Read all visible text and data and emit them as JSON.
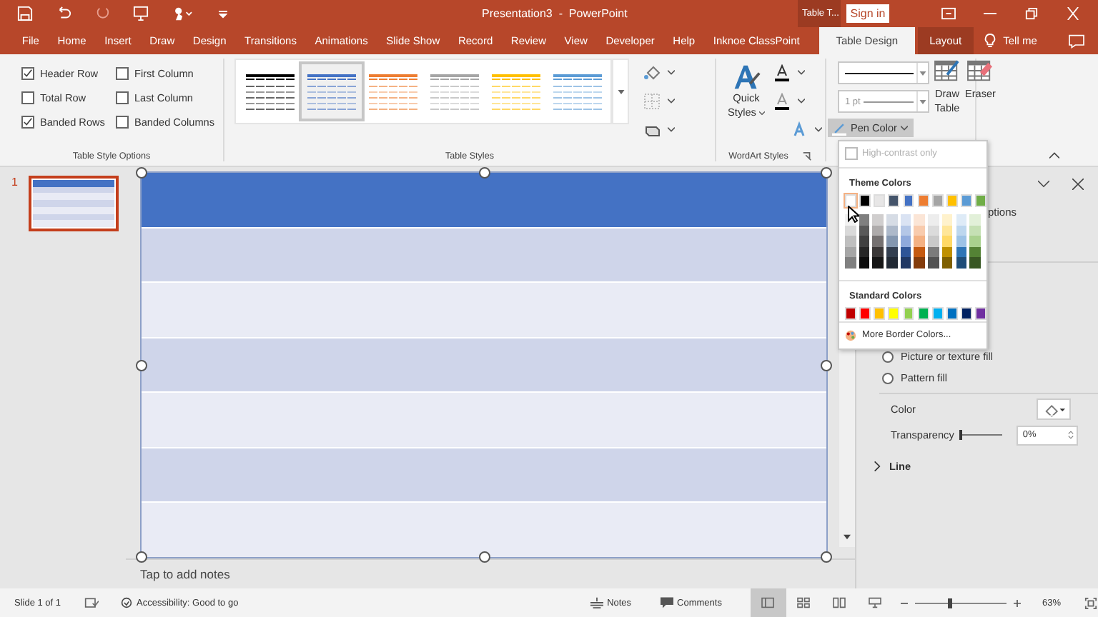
{
  "title_bar": {
    "title": "Presentation3  -  PowerPoint",
    "context_label": "Table T...",
    "sign_in": "Sign in"
  },
  "tabs": [
    {
      "label": "File",
      "selected": false,
      "kind": "normal"
    },
    {
      "label": "Home",
      "selected": false,
      "kind": "normal"
    },
    {
      "label": "Insert",
      "selected": false,
      "kind": "normal"
    },
    {
      "label": "Draw",
      "selected": false,
      "kind": "normal"
    },
    {
      "label": "Design",
      "selected": false,
      "kind": "normal"
    },
    {
      "label": "Transitions",
      "selected": false,
      "kind": "normal"
    },
    {
      "label": "Animations",
      "selected": false,
      "kind": "normal"
    },
    {
      "label": "Slide Show",
      "selected": false,
      "kind": "normal"
    },
    {
      "label": "Record",
      "selected": false,
      "kind": "normal"
    },
    {
      "label": "Review",
      "selected": false,
      "kind": "normal"
    },
    {
      "label": "View",
      "selected": false,
      "kind": "normal"
    },
    {
      "label": "Developer",
      "selected": false,
      "kind": "normal"
    },
    {
      "label": "Help",
      "selected": false,
      "kind": "normal"
    },
    {
      "label": "Inknoe ClassPoint",
      "selected": false,
      "kind": "normal"
    },
    {
      "label": "Table Design",
      "selected": true,
      "kind": "context"
    },
    {
      "label": "Layout",
      "selected": false,
      "kind": "context"
    }
  ],
  "tell_me": "Tell me",
  "ribbon": {
    "style_options": {
      "group_label": "Table Style Options",
      "items": [
        {
          "label": "Header Row",
          "checked": true
        },
        {
          "label": "First Column",
          "checked": false
        },
        {
          "label": "Total Row",
          "checked": false
        },
        {
          "label": "Last Column",
          "checked": false
        },
        {
          "label": "Banded Rows",
          "checked": true
        },
        {
          "label": "Banded Columns",
          "checked": false
        }
      ]
    },
    "table_styles": {
      "group_label": "Table Styles",
      "items": [
        {
          "color": "#000000",
          "selected": false
        },
        {
          "color": "#4472c4",
          "selected": true
        },
        {
          "color": "#ed7d31",
          "selected": false
        },
        {
          "color": "#a5a5a5",
          "selected": false
        },
        {
          "color": "#ffc000",
          "selected": false
        },
        {
          "color": "#5b9bd5",
          "selected": false
        }
      ]
    },
    "wordart": {
      "group_label": "WordArt Styles",
      "quick_styles": "Quick Styles"
    },
    "borders": {
      "pen_weight": "1 pt",
      "pen_color": "Pen Color",
      "draw_table": "Draw Table",
      "eraser": "Eraser"
    }
  },
  "pen_color_menu": {
    "high_contrast": {
      "label": "High-contrast only",
      "checked": false,
      "disabled": true
    },
    "theme_label": "Theme Colors",
    "theme_colors": [
      {
        "color": "#ffffff",
        "selected": true,
        "shades": [
          {
            "color": "#f2f2f2"
          },
          {
            "color": "#d9d9d9"
          },
          {
            "color": "#bfbfbf"
          },
          {
            "color": "#a6a6a6"
          },
          {
            "color": "#808080"
          }
        ]
      },
      {
        "color": "#000000",
        "selected": false,
        "shades": [
          {
            "color": "#7f7f7f"
          },
          {
            "color": "#595959"
          },
          {
            "color": "#404040"
          },
          {
            "color": "#262626"
          },
          {
            "color": "#0d0d0d"
          }
        ]
      },
      {
        "color": "#e7e6e6",
        "selected": false,
        "shades": [
          {
            "color": "#d0cece"
          },
          {
            "color": "#aeabab"
          },
          {
            "color": "#757171"
          },
          {
            "color": "#3b3838"
          },
          {
            "color": "#161616"
          }
        ]
      },
      {
        "color": "#44546a",
        "selected": false,
        "shades": [
          {
            "color": "#d6dce5"
          },
          {
            "color": "#adb9ca"
          },
          {
            "color": "#8497b0"
          },
          {
            "color": "#333f50"
          },
          {
            "color": "#222a35"
          }
        ]
      },
      {
        "color": "#4472c4",
        "selected": false,
        "shades": [
          {
            "color": "#dae3f3"
          },
          {
            "color": "#b4c7e7"
          },
          {
            "color": "#8faadc"
          },
          {
            "color": "#2f5597"
          },
          {
            "color": "#203864"
          }
        ]
      },
      {
        "color": "#ed7d31",
        "selected": false,
        "shades": [
          {
            "color": "#fbe5d6"
          },
          {
            "color": "#f8cbad"
          },
          {
            "color": "#f4b183"
          },
          {
            "color": "#c55a11"
          },
          {
            "color": "#843c0c"
          }
        ]
      },
      {
        "color": "#a5a5a5",
        "selected": false,
        "shades": [
          {
            "color": "#ededed"
          },
          {
            "color": "#dbdbdb"
          },
          {
            "color": "#c9c9c9"
          },
          {
            "color": "#7b7b7b"
          },
          {
            "color": "#525252"
          }
        ]
      },
      {
        "color": "#ffc000",
        "selected": false,
        "shades": [
          {
            "color": "#fff2cc"
          },
          {
            "color": "#ffe699"
          },
          {
            "color": "#ffd966"
          },
          {
            "color": "#bf9000"
          },
          {
            "color": "#7f6000"
          }
        ]
      },
      {
        "color": "#5b9bd5",
        "selected": false,
        "shades": [
          {
            "color": "#deebf7"
          },
          {
            "color": "#bdd7ee"
          },
          {
            "color": "#9dc3e6"
          },
          {
            "color": "#2e75b6"
          },
          {
            "color": "#1f4e79"
          }
        ]
      },
      {
        "color": "#70ad47",
        "selected": false,
        "shades": [
          {
            "color": "#e2f0d9"
          },
          {
            "color": "#c5e0b4"
          },
          {
            "color": "#a9d18e"
          },
          {
            "color": "#548235"
          },
          {
            "color": "#385723"
          }
        ]
      }
    ],
    "standard_label": "Standard Colors",
    "standard_colors": [
      {
        "color": "#c00000"
      },
      {
        "color": "#ff0000"
      },
      {
        "color": "#ffc000"
      },
      {
        "color": "#ffff00"
      },
      {
        "color": "#92d050"
      },
      {
        "color": "#00b050"
      },
      {
        "color": "#00b0f0"
      },
      {
        "color": "#0070c0"
      },
      {
        "color": "#002060"
      },
      {
        "color": "#7030a0"
      }
    ],
    "more_colors": "More Border Colors..."
  },
  "slides": [
    {
      "number": "1",
      "selected": true
    }
  ],
  "table": {
    "rows": [
      {
        "kind": "header"
      },
      {
        "kind": "dark"
      },
      {
        "kind": "light"
      },
      {
        "kind": "dark"
      },
      {
        "kind": "light"
      },
      {
        "kind": "dark"
      },
      {
        "kind": "light"
      }
    ]
  },
  "notes_placeholder": "Tap to add notes",
  "format_pane": {
    "cut_heading": "ptions",
    "fill_options": [
      {
        "label": "Picture or texture fill",
        "selected": false
      },
      {
        "label": "Pattern fill",
        "selected": false
      }
    ],
    "color_label": "Color",
    "transparency_label": "Transparency",
    "transparency": {
      "level": 0,
      "value": "0%"
    },
    "line_section": {
      "label": "Line",
      "expanded": false
    }
  },
  "status_bar": {
    "slide": "Slide 1 of 1",
    "accessibility": "Accessibility: Good to go",
    "notes": "Notes",
    "comments": "Comments",
    "views": [
      {
        "kind": "normal",
        "selected": true
      },
      {
        "kind": "sorter",
        "selected": false
      },
      {
        "kind": "reading",
        "selected": false
      },
      {
        "kind": "show",
        "selected": false
      }
    ],
    "zoom": {
      "level": 0.36,
      "value": "63%"
    }
  }
}
